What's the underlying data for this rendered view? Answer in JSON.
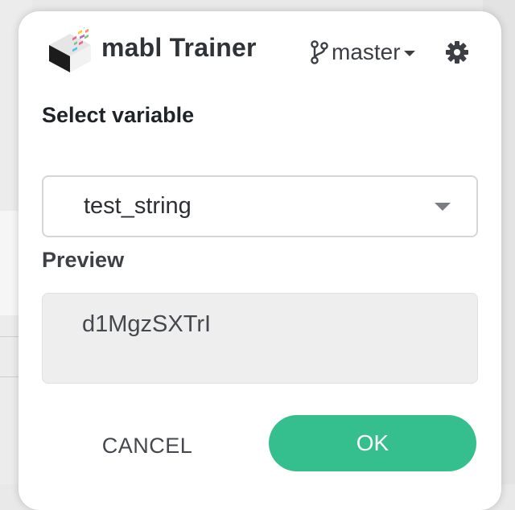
{
  "header": {
    "app_title": "mabl Trainer",
    "branch_label": "master",
    "branch_icon": "git-branch-icon",
    "settings_icon": "gear-icon"
  },
  "form": {
    "select_label": "Select variable",
    "selected_variable": "test_string",
    "preview_label": "Preview",
    "preview_value": "d1MgzSXTrI"
  },
  "actions": {
    "cancel_label": "CANCEL",
    "ok_label": "OK"
  },
  "colors": {
    "accent": "#35bf8e",
    "title_text": "#2f3237",
    "preview_bg": "#eeeeee"
  }
}
